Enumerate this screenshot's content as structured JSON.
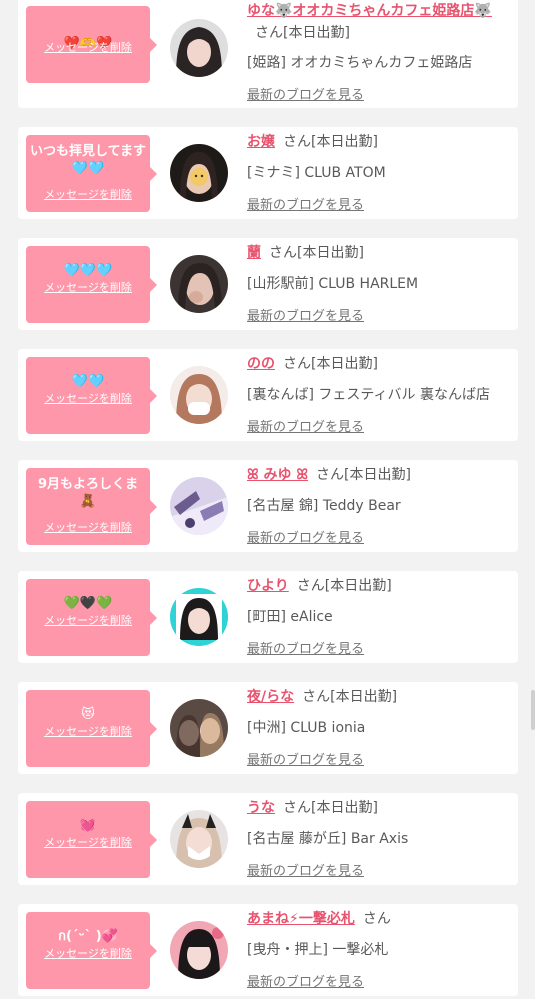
{
  "ui": {
    "delete_label": "メッセージを削除",
    "blog_label": "最新のブログを見る",
    "san": "さん",
    "attendance": "[本日出勤]"
  },
  "colors": {
    "bubble": "#fd97a9",
    "name": "#e8536e",
    "text": "#595959",
    "background": "#f2f2f2"
  },
  "cards": [
    {
      "message": "❤️🫶❤️",
      "name": "ゆな🐺オオカミちゃんカフェ姫路店🐺",
      "shop": "[姫路] オオカミちゃんカフェ姫路店"
    },
    {
      "message": "いつも拝見してます🩵🩵",
      "name": "お嬢",
      "shop": "[ミナミ] CLUB ATOM"
    },
    {
      "message": "🩵🩵🩵",
      "name": "蘭",
      "shop": "[山形駅前] CLUB HARLEM"
    },
    {
      "message": "🩵🩵",
      "name": "のの",
      "shop": "[裏なんば] フェスティバル 裏なんば店"
    },
    {
      "message": "9月もよろしくま🧸",
      "name": "ꕤ みゆ ꕤ",
      "shop": "[名古屋 錦] Teddy Bear"
    },
    {
      "message": "💚🖤💚",
      "name": "ひより",
      "shop": "[町田] eAlice"
    },
    {
      "message": "😻",
      "name": "夜/らな",
      "shop": "[中洲] CLUB ionia"
    },
    {
      "message": "💓",
      "name": "うな",
      "shop": "[名古屋 藤が丘] Bar Axis"
    },
    {
      "message": "ก(ˊᵕˋ )💞",
      "name": "あまね⚡一撃必札",
      "shop": "[曳舟・押上] 一撃必札"
    }
  ]
}
